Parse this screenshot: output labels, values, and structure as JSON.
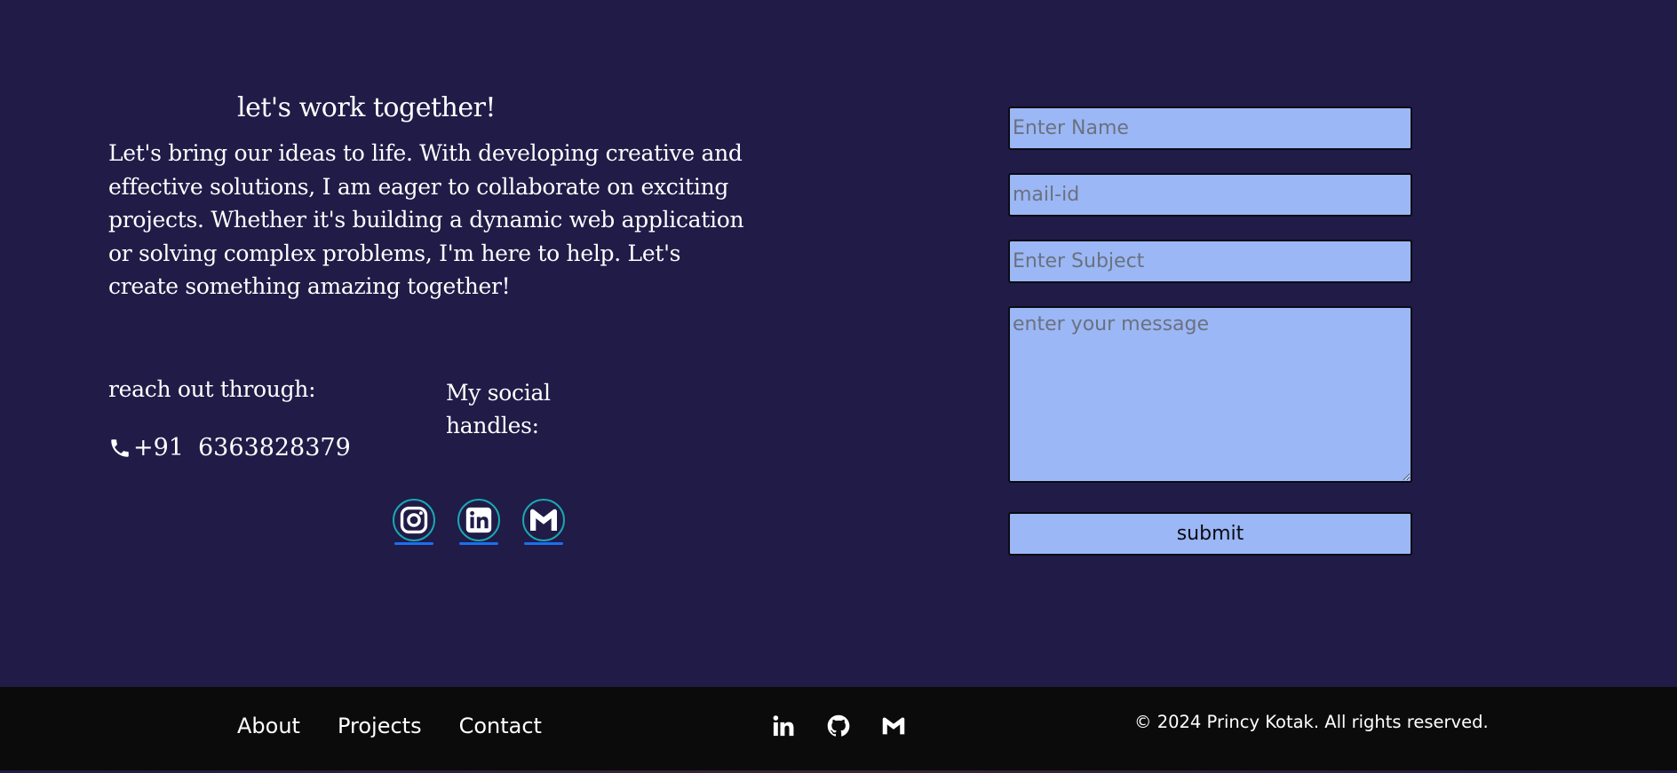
{
  "contact": {
    "heading": "let's work together!",
    "intro": "Let's bring our ideas to life. With developing creative and effective solutions, I am eager to collaborate on exciting projects. Whether it's building a dynamic web application or solving complex problems, I'm here to help. Let's create something amazing together!",
    "reach_label": "reach out through:",
    "phone_icon": "phone-icon",
    "phone_code": "+91",
    "phone_number": "6363828379",
    "social_label": "My social handles:",
    "social_icons": [
      "instagram-icon",
      "linkedin-icon",
      "gmail-icon"
    ]
  },
  "form": {
    "name_placeholder": "Enter Name",
    "mail_placeholder": "mail-id",
    "subject_placeholder": "Enter Subject",
    "message_placeholder": "enter your message",
    "submit_label": "submit"
  },
  "footer": {
    "nav": [
      "About",
      "Projects",
      "Contact"
    ],
    "icons": [
      "linkedin-icon",
      "github-icon",
      "gmail-icon"
    ],
    "copyright": "© 2024 Princy Kotak. All rights reserved."
  },
  "colors": {
    "background": "#201b47",
    "field_background": "#9bb7f5",
    "footer_background": "#0b0b0b",
    "icon_ring": "#1aa7b0",
    "icon_underline": "#1c6ff0"
  }
}
